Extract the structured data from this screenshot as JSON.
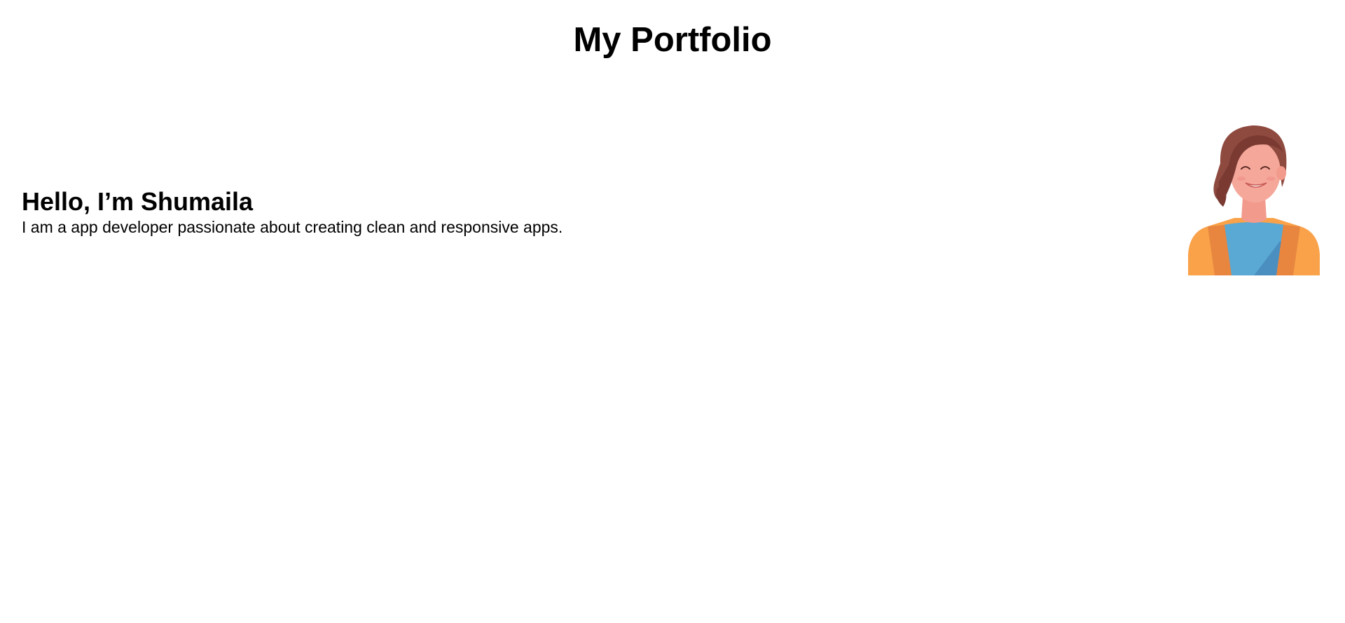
{
  "header": {
    "title": "My Portfolio"
  },
  "hero": {
    "heading": "Hello, I’m Shumaila",
    "description": "I am a app developer passionate about creating clean and responsive apps.",
    "avatar_icon": "woman-avatar-illustration"
  },
  "colors": {
    "hair": "#8e4a3f",
    "skin": "#f5a79a",
    "shirt": "#5aa8d4",
    "jacket": "#f9a24a"
  }
}
